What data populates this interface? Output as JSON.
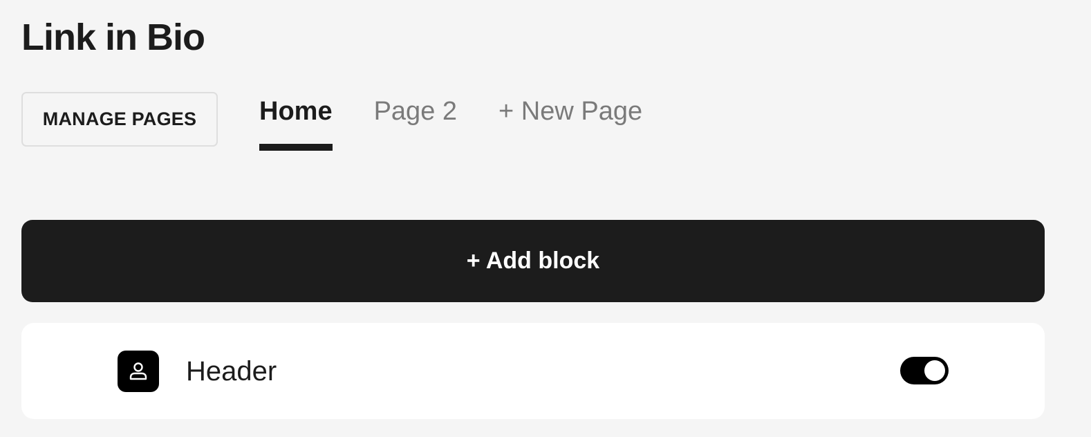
{
  "header": {
    "title": "Link in Bio"
  },
  "toolbar": {
    "manage_pages_label": "MANAGE PAGES"
  },
  "tabs": [
    {
      "label": "Home",
      "active": true
    },
    {
      "label": "Page 2",
      "active": false
    },
    {
      "label": "+ New Page",
      "active": false
    }
  ],
  "add_block": {
    "label": "+ Add block"
  },
  "blocks": [
    {
      "label": "Header",
      "icon": "user-icon",
      "enabled": true
    }
  ],
  "colors": {
    "background": "#f5f5f5",
    "primary": "#1c1c1c",
    "muted_text": "#7a7a7a",
    "card": "#ffffff"
  }
}
